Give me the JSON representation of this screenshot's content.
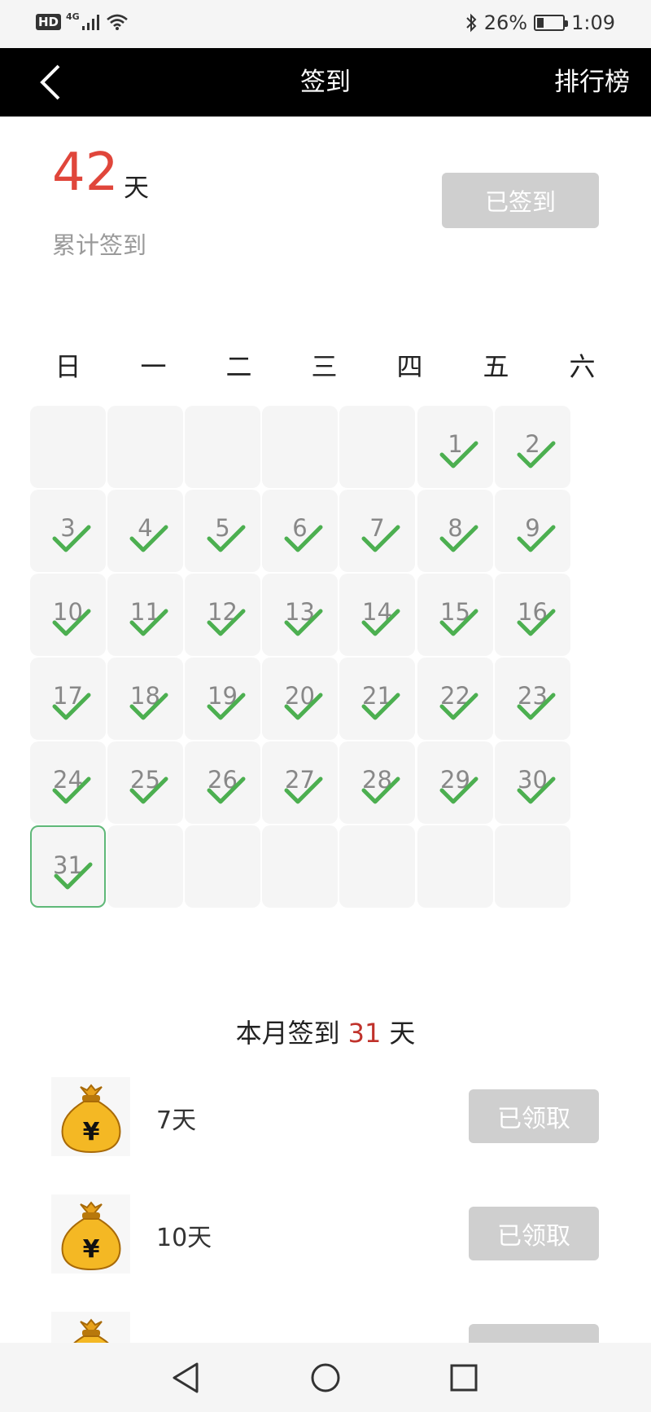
{
  "status_bar": {
    "hd": "HD",
    "network": "4G",
    "battery_percent": "26%",
    "battery_level": 0.26,
    "time": "1:09",
    "icons": [
      "signal-icon",
      "wifi-icon",
      "bluetooth-icon",
      "battery-icon"
    ]
  },
  "header": {
    "back_icon": "back-arrow-icon",
    "title": "签到",
    "ranking": "排行榜"
  },
  "summary": {
    "total_days": "42",
    "unit": "天",
    "label": "累计签到",
    "signed_button": "已签到"
  },
  "calendar": {
    "weekdays": [
      "日",
      "一",
      "二",
      "三",
      "四",
      "五",
      "六"
    ],
    "first_weekday_index": 5,
    "days_in_month": 31,
    "checked_days": [
      1,
      2,
      3,
      4,
      5,
      6,
      7,
      8,
      9,
      10,
      11,
      12,
      13,
      14,
      15,
      16,
      17,
      18,
      19,
      20,
      21,
      22,
      23,
      24,
      25,
      26,
      27,
      28,
      29,
      30,
      31
    ],
    "today": 31,
    "check_color": "#4caf50",
    "today_border_color": "#5fb878"
  },
  "month_summary": {
    "prefix": "本月签到",
    "count": "31",
    "suffix": "天"
  },
  "rewards": [
    {
      "label": "7天",
      "button": "已领取",
      "icon": "money-bag-icon"
    },
    {
      "label": "10天",
      "button": "已领取",
      "icon": "money-bag-icon"
    }
  ],
  "nav_bar": {
    "icons": [
      "nav-back-icon",
      "nav-home-icon",
      "nav-recents-icon"
    ]
  },
  "colors": {
    "accent_red": "#e0463b",
    "disabled_button": "#cfcfcf",
    "header_bg": "#000000"
  }
}
